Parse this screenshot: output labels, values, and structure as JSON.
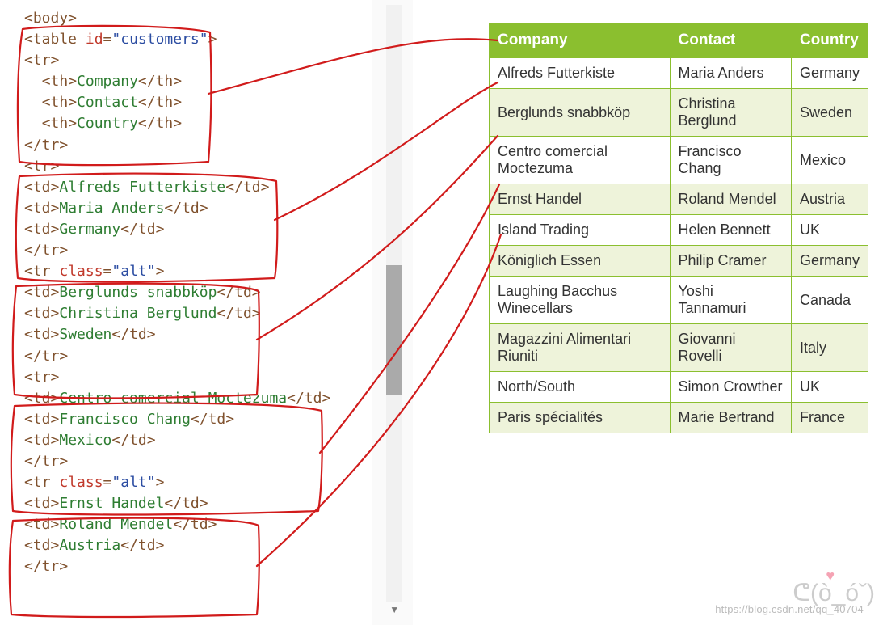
{
  "code": {
    "lines": [
      [
        [
          "tag",
          "<body>"
        ]
      ],
      [
        [
          "tag",
          "<table "
        ],
        [
          "attr",
          "id"
        ],
        [
          "tag",
          "="
        ],
        [
          "str",
          "\"customers\""
        ],
        [
          "tag",
          ">"
        ]
      ],
      [
        [
          "tag",
          "<tr>"
        ]
      ],
      [
        [
          "txt",
          "  "
        ],
        [
          "tag",
          "<th>"
        ],
        [
          "txt",
          "Company"
        ],
        [
          "tag",
          "</th>"
        ]
      ],
      [
        [
          "txt",
          "  "
        ],
        [
          "tag",
          "<th>"
        ],
        [
          "txt",
          "Contact"
        ],
        [
          "tag",
          "</th>"
        ]
      ],
      [
        [
          "txt",
          "  "
        ],
        [
          "tag",
          "<th>"
        ],
        [
          "txt",
          "Country"
        ],
        [
          "tag",
          "</th>"
        ]
      ],
      [
        [
          "tag",
          "</tr>"
        ]
      ],
      [
        [
          "tag",
          "<tr>"
        ]
      ],
      [
        [
          "tag",
          "<td>"
        ],
        [
          "txt",
          "Alfreds Futterkiste"
        ],
        [
          "tag",
          "</td>"
        ]
      ],
      [
        [
          "tag",
          "<td>"
        ],
        [
          "txt",
          "Maria Anders"
        ],
        [
          "tag",
          "</td>"
        ]
      ],
      [
        [
          "tag",
          "<td>"
        ],
        [
          "txt",
          "Germany"
        ],
        [
          "tag",
          "</td>"
        ]
      ],
      [
        [
          "tag",
          "</tr>"
        ]
      ],
      [
        [
          "tag",
          "<tr "
        ],
        [
          "attr",
          "class"
        ],
        [
          "tag",
          "="
        ],
        [
          "str",
          "\"alt\""
        ],
        [
          "tag",
          ">"
        ]
      ],
      [
        [
          "tag",
          "<td>"
        ],
        [
          "txt",
          "Berglunds snabbköp"
        ],
        [
          "tag",
          "</td>"
        ]
      ],
      [
        [
          "tag",
          "<td>"
        ],
        [
          "txt",
          "Christina Berglund"
        ],
        [
          "tag",
          "</td>"
        ]
      ],
      [
        [
          "tag",
          "<td>"
        ],
        [
          "txt",
          "Sweden"
        ],
        [
          "tag",
          "</td>"
        ]
      ],
      [
        [
          "tag",
          "</tr>"
        ]
      ],
      [
        [
          "tag",
          "<tr>"
        ]
      ],
      [
        [
          "tag",
          "<td>"
        ],
        [
          "txt",
          "Centro comercial Moctezuma"
        ],
        [
          "tag",
          "</td>"
        ]
      ],
      [
        [
          "tag",
          "<td>"
        ],
        [
          "txt",
          "Francisco Chang"
        ],
        [
          "tag",
          "</td>"
        ]
      ],
      [
        [
          "tag",
          "<td>"
        ],
        [
          "txt",
          "Mexico"
        ],
        [
          "tag",
          "</td>"
        ]
      ],
      [
        [
          "tag",
          "</tr>"
        ]
      ],
      [
        [
          "tag",
          "<tr "
        ],
        [
          "attr",
          "class"
        ],
        [
          "tag",
          "="
        ],
        [
          "str",
          "\"alt\""
        ],
        [
          "tag",
          ">"
        ]
      ],
      [
        [
          "tag",
          "<td>"
        ],
        [
          "txt",
          "Ernst Handel"
        ],
        [
          "tag",
          "</td>"
        ]
      ],
      [
        [
          "tag",
          "<td>"
        ],
        [
          "txt",
          "Roland Mendel"
        ],
        [
          "tag",
          "</td>"
        ]
      ],
      [
        [
          "tag",
          "<td>"
        ],
        [
          "txt",
          "Austria"
        ],
        [
          "tag",
          "</td>"
        ]
      ],
      [
        [
          "tag",
          "</tr>"
        ]
      ]
    ]
  },
  "table": {
    "headers": [
      "Company",
      "Contact",
      "Country"
    ],
    "rows": [
      {
        "alt": false,
        "cells": [
          "Alfreds Futterkiste",
          "Maria Anders",
          "Germany"
        ]
      },
      {
        "alt": true,
        "cells": [
          "Berglunds snabbköp",
          "Christina Berglund",
          "Sweden"
        ]
      },
      {
        "alt": false,
        "cells": [
          "Centro comercial Moctezuma",
          "Francisco Chang",
          "Mexico"
        ]
      },
      {
        "alt": true,
        "cells": [
          "Ernst Handel",
          "Roland Mendel",
          "Austria"
        ]
      },
      {
        "alt": false,
        "cells": [
          "Island Trading",
          "Helen Bennett",
          "UK"
        ]
      },
      {
        "alt": true,
        "cells": [
          "Königlich Essen",
          "Philip Cramer",
          "Germany"
        ]
      },
      {
        "alt": false,
        "cells": [
          "Laughing Bacchus Winecellars",
          "Yoshi Tannamuri",
          "Canada"
        ]
      },
      {
        "alt": true,
        "cells": [
          "Magazzini Alimentari Riuniti",
          "Giovanni Rovelli",
          "Italy"
        ]
      },
      {
        "alt": false,
        "cells": [
          "North/South",
          "Simon Crowther",
          "UK"
        ]
      },
      {
        "alt": true,
        "cells": [
          "Paris spécialités",
          "Marie Bertrand",
          "France"
        ]
      }
    ]
  },
  "watermark": "https://blog.csdn.net/qq_40704"
}
